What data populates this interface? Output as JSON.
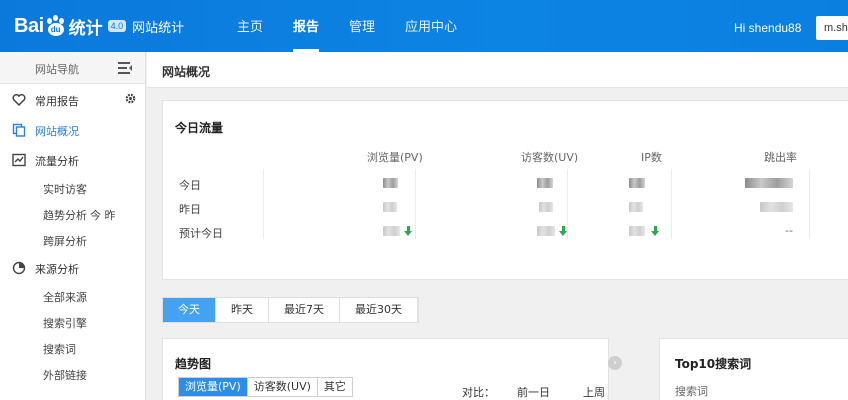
{
  "header": {
    "logo_bai": "Bai",
    "logo_du": "du",
    "logo_tongji": "统计",
    "logo_badge": "4.0",
    "site_title": "网站统计",
    "nav": [
      "主页",
      "报告",
      "管理",
      "应用中心"
    ],
    "active_nav": "报告",
    "user": "Hi shendu88",
    "site_selector": "m.sho"
  },
  "sidebar": {
    "title": "网站导航",
    "favorites": "常用报告",
    "overview": "网站概况",
    "traffic": {
      "label": "流量分析",
      "items": [
        "实时访客",
        "趋势分析",
        "跨屏分析"
      ],
      "trend_extra": "今 昨"
    },
    "source": {
      "label": "来源分析",
      "items": [
        "全部来源",
        "搜索引擎",
        "搜索词",
        "外部链接"
      ]
    }
  },
  "main": {
    "page_title": "网站概况",
    "today": {
      "title": "今日流量",
      "columns": [
        "浏览量(PV)",
        "访客数(UV)",
        "IP数",
        "跳出率"
      ],
      "rows": [
        "今日",
        "昨日",
        "预计今日"
      ],
      "dash": "--"
    },
    "date_tabs": [
      "今天",
      "昨天",
      "最近7天",
      "最近30天"
    ],
    "active_date_tab": "今天",
    "trend": {
      "title": "趋势图",
      "metrics": [
        "浏览量(PV)",
        "访客数(UV)",
        "其它"
      ],
      "active_metric": "浏览量(PV)",
      "compare_label": "对比：",
      "compare_options": [
        "前一日",
        "上周同期"
      ]
    },
    "top10": {
      "title": "Top10搜索词",
      "column": "搜索词"
    }
  },
  "colors": {
    "header_blue": "#0b79dc",
    "active_tab_blue": "#44a2f0",
    "decrease_green": "#2fa84f",
    "link_blue": "#2b7fd9"
  }
}
